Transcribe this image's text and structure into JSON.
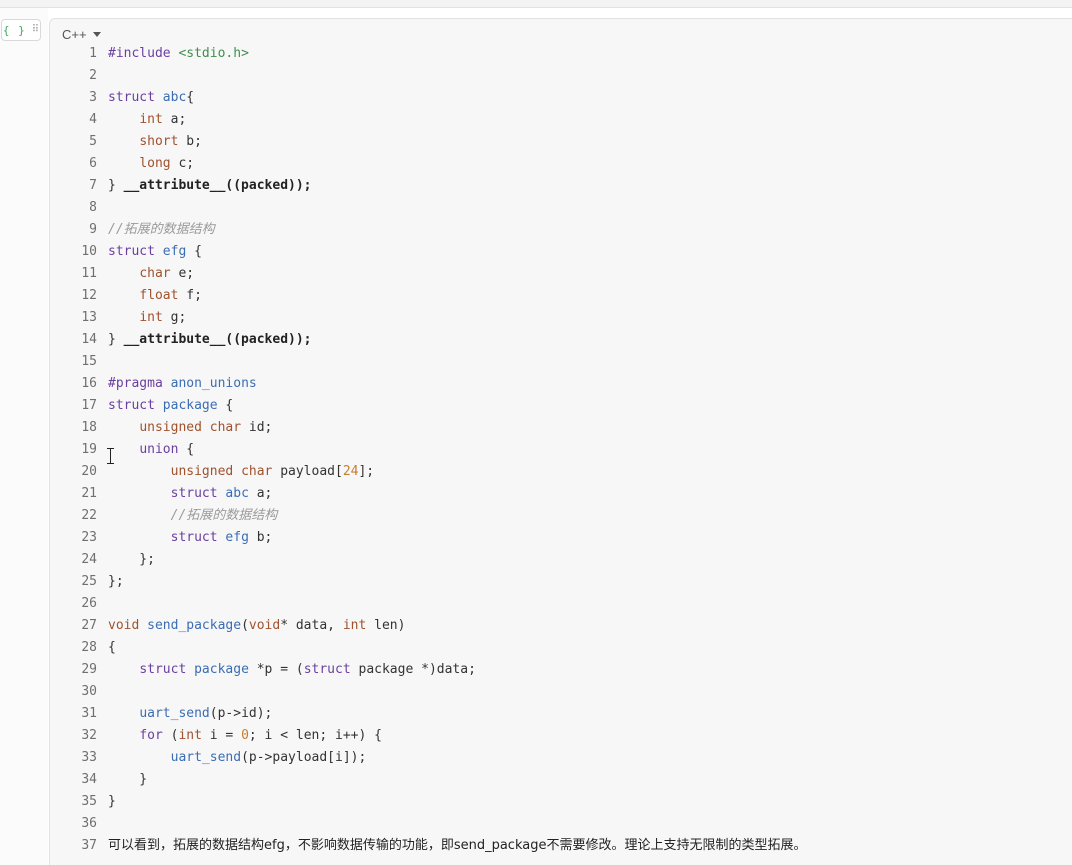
{
  "editor": {
    "language": "C++",
    "block_handle_glyph": "{ }",
    "drag_glyph": "⠿"
  },
  "lines": [
    {
      "n": "1",
      "segs": [
        [
          "st",
          "#include "
        ],
        [
          "inc",
          "<stdio.h>"
        ]
      ]
    },
    {
      "n": "2",
      "segs": []
    },
    {
      "n": "3",
      "segs": [
        [
          "st",
          "struct "
        ],
        [
          "ty",
          "abc"
        ],
        [
          "",
          "{"
        ]
      ]
    },
    {
      "n": "4",
      "segs": [
        [
          "",
          "    "
        ],
        [
          "kw",
          "int"
        ],
        [
          "",
          " a;"
        ]
      ]
    },
    {
      "n": "5",
      "segs": [
        [
          "",
          "    "
        ],
        [
          "kw",
          "short"
        ],
        [
          "",
          " b;"
        ]
      ]
    },
    {
      "n": "6",
      "segs": [
        [
          "",
          "    "
        ],
        [
          "kw",
          "long"
        ],
        [
          "",
          " c;"
        ]
      ]
    },
    {
      "n": "7",
      "segs": [
        [
          "",
          "} "
        ],
        [
          "bold",
          "__attribute__((packed));"
        ]
      ]
    },
    {
      "n": "8",
      "segs": []
    },
    {
      "n": "9",
      "segs": [
        [
          "cm",
          "//拓展的数据结构"
        ]
      ]
    },
    {
      "n": "10",
      "segs": [
        [
          "st",
          "struct "
        ],
        [
          "ty",
          "efg"
        ],
        [
          "",
          " {"
        ]
      ]
    },
    {
      "n": "11",
      "segs": [
        [
          "",
          "    "
        ],
        [
          "kw",
          "char"
        ],
        [
          "",
          " e;"
        ]
      ]
    },
    {
      "n": "12",
      "segs": [
        [
          "",
          "    "
        ],
        [
          "kw",
          "float"
        ],
        [
          "",
          " f;"
        ]
      ]
    },
    {
      "n": "13",
      "segs": [
        [
          "",
          "    "
        ],
        [
          "kw",
          "int"
        ],
        [
          "",
          " g;"
        ]
      ]
    },
    {
      "n": "14",
      "segs": [
        [
          "",
          "} "
        ],
        [
          "bold",
          "__attribute__((packed));"
        ]
      ]
    },
    {
      "n": "15",
      "segs": []
    },
    {
      "n": "16",
      "segs": [
        [
          "st",
          "#pragma "
        ],
        [
          "ty",
          "anon_unions"
        ]
      ]
    },
    {
      "n": "17",
      "segs": [
        [
          "st",
          "struct "
        ],
        [
          "ty",
          "package"
        ],
        [
          "",
          " {"
        ]
      ]
    },
    {
      "n": "18",
      "segs": [
        [
          "",
          "    "
        ],
        [
          "kw",
          "unsigned char"
        ],
        [
          "",
          " id;"
        ]
      ]
    },
    {
      "n": "19",
      "segs": [
        [
          "",
          "    "
        ],
        [
          "st",
          "union"
        ],
        [
          "",
          " {"
        ]
      ]
    },
    {
      "n": "20",
      "segs": [
        [
          "",
          "        "
        ],
        [
          "kw",
          "unsigned char"
        ],
        [
          "",
          " payload["
        ],
        [
          "num",
          "24"
        ],
        [
          "",
          "];"
        ]
      ]
    },
    {
      "n": "21",
      "segs": [
        [
          "",
          "        "
        ],
        [
          "st",
          "struct "
        ],
        [
          "ty",
          "abc"
        ],
        [
          "",
          " a;"
        ]
      ]
    },
    {
      "n": "22",
      "segs": [
        [
          "",
          "        "
        ],
        [
          "cm",
          "//拓展的数据结构"
        ]
      ]
    },
    {
      "n": "23",
      "segs": [
        [
          "",
          "        "
        ],
        [
          "st",
          "struct "
        ],
        [
          "ty",
          "efg"
        ],
        [
          "",
          " b;"
        ]
      ]
    },
    {
      "n": "24",
      "segs": [
        [
          "",
          "    };"
        ]
      ]
    },
    {
      "n": "25",
      "segs": [
        [
          "",
          "};"
        ]
      ]
    },
    {
      "n": "26",
      "segs": []
    },
    {
      "n": "27",
      "segs": [
        [
          "kw",
          "void "
        ],
        [
          "fn",
          "send_package"
        ],
        [
          "",
          "("
        ],
        [
          "kw",
          "void"
        ],
        [
          "",
          "* data, "
        ],
        [
          "kw",
          "int"
        ],
        [
          "",
          " len)"
        ]
      ]
    },
    {
      "n": "28",
      "segs": [
        [
          "",
          "{"
        ]
      ]
    },
    {
      "n": "29",
      "segs": [
        [
          "",
          "    "
        ],
        [
          "st",
          "struct "
        ],
        [
          "ty",
          "package"
        ],
        [
          "",
          " *p = ("
        ],
        [
          "st",
          "struct "
        ],
        [
          "",
          "package *)data;"
        ]
      ]
    },
    {
      "n": "30",
      "segs": []
    },
    {
      "n": "31",
      "segs": [
        [
          "",
          "    "
        ],
        [
          "fn",
          "uart_send"
        ],
        [
          "",
          "(p->id);"
        ]
      ]
    },
    {
      "n": "32",
      "segs": [
        [
          "",
          "    "
        ],
        [
          "st",
          "for"
        ],
        [
          "",
          " ("
        ],
        [
          "kw",
          "int"
        ],
        [
          "",
          " i = "
        ],
        [
          "num",
          "0"
        ],
        [
          "",
          "; i < len; i++) {"
        ]
      ]
    },
    {
      "n": "33",
      "segs": [
        [
          "",
          "        "
        ],
        [
          "fn",
          "uart_send"
        ],
        [
          "",
          "(p->payload[i]);"
        ]
      ]
    },
    {
      "n": "34",
      "segs": [
        [
          "",
          "    }"
        ]
      ]
    },
    {
      "n": "35",
      "segs": [
        [
          "",
          "}"
        ]
      ]
    },
    {
      "n": "36",
      "segs": []
    },
    {
      "n": "37",
      "segs": [
        [
          "text-cn",
          "可以看到，拓展的数据结构efg，不影响数据传输的功能，即send_package不需要修改。理论上支持无限制的类型拓展。"
        ]
      ]
    }
  ]
}
